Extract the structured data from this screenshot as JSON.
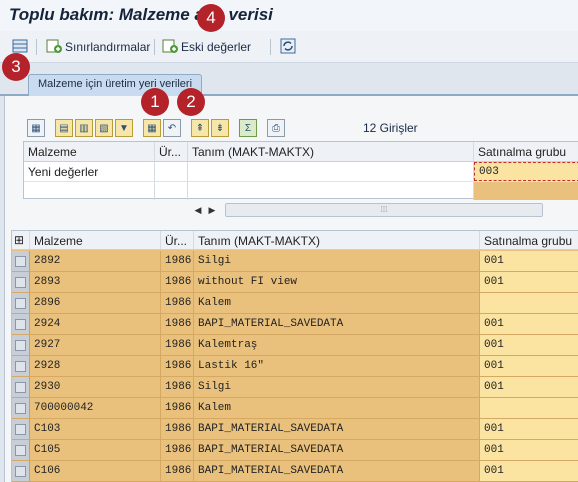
{
  "window": {
    "title": "Toplu bakım: Malzeme ana verisi"
  },
  "toolbar": {
    "restrictions_label": "Sınırlandırmalar",
    "old_values_label": "Eski değerler"
  },
  "tabs": [
    {
      "label": "Malzeme için üretim yeri verileri"
    }
  ],
  "grid": {
    "entries_label": "12  Girişler"
  },
  "upper_table": {
    "columns": [
      "Malzeme",
      "Ür...",
      "Tanım (MAKT-MAKTX)",
      "Satınalma grubu"
    ],
    "new_values_row": {
      "material": "Yeni değerler",
      "plant": "",
      "description": "",
      "purchasing_group": "003"
    }
  },
  "lower_table": {
    "columns": [
      "Malzeme",
      "Ür...",
      "Tanım (MAKT-MAKTX)",
      "Satınalma grubu"
    ],
    "rows": [
      {
        "material": "2892",
        "plant": "1986",
        "description": "Silgi",
        "purchasing_group": "001"
      },
      {
        "material": "2893",
        "plant": "1986",
        "description": "without FI view",
        "purchasing_group": "001"
      },
      {
        "material": "2896",
        "plant": "1986",
        "description": "Kalem",
        "purchasing_group": ""
      },
      {
        "material": "2924",
        "plant": "1986",
        "description": "BAPI_MATERIAL_SAVEDATA",
        "purchasing_group": "001"
      },
      {
        "material": "2927",
        "plant": "1986",
        "description": "Kalemtraş",
        "purchasing_group": "001"
      },
      {
        "material": "2928",
        "plant": "1986",
        "description": "Lastik 16\"",
        "purchasing_group": "001"
      },
      {
        "material": "2930",
        "plant": "1986",
        "description": "Silgi",
        "purchasing_group": "001"
      },
      {
        "material": "700000042",
        "plant": "1986",
        "description": "Kalem",
        "purchasing_group": ""
      },
      {
        "material": "C103",
        "plant": "1986",
        "description": "BAPI_MATERIAL_SAVEDATA",
        "purchasing_group": "001"
      },
      {
        "material": "C105",
        "plant": "1986",
        "description": "BAPI_MATERIAL_SAVEDATA",
        "purchasing_group": "001"
      },
      {
        "material": "C106",
        "plant": "1986",
        "description": "BAPI_MATERIAL_SAVEDATA",
        "purchasing_group": "001"
      }
    ]
  },
  "badges": [
    "1",
    "2",
    "3",
    "4"
  ],
  "colors": {
    "badge": "#b4232a",
    "row_bg": "#e9c17c",
    "highlight": "#fbe3a2"
  }
}
